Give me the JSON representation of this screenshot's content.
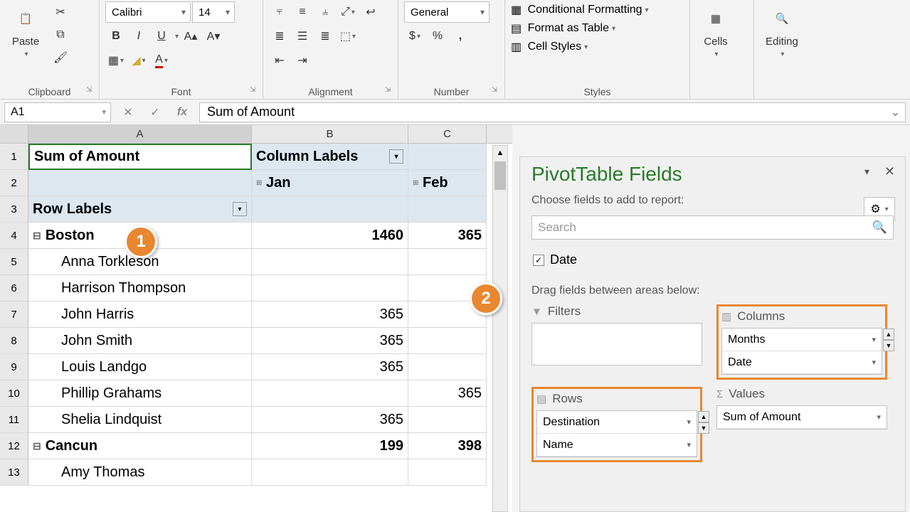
{
  "ribbon": {
    "clipboard": {
      "paste": "Paste",
      "label": "Clipboard"
    },
    "font": {
      "name": "Calibri",
      "size": "14",
      "label": "Font",
      "bold": "B",
      "italic": "I",
      "underline": "U"
    },
    "alignment": {
      "label": "Alignment"
    },
    "number": {
      "format": "General",
      "label": "Number"
    },
    "styles": {
      "cond": "Conditional Formatting",
      "table": "Format as Table",
      "cell": "Cell Styles",
      "label": "Styles"
    },
    "cells": {
      "label": "Cells"
    },
    "editing": {
      "label": "Editing"
    }
  },
  "formula": {
    "name_ref": "A1",
    "value": "Sum of Amount"
  },
  "columns": [
    "A",
    "B",
    "C"
  ],
  "grid": {
    "r1": {
      "a": "Sum of Amount",
      "b": "Column Labels"
    },
    "r2": {
      "b": "Jan",
      "c": "Feb"
    },
    "r3": {
      "a": "Row Labels"
    },
    "r4": {
      "a": "Boston",
      "b": "1460",
      "c": "365"
    },
    "r5": {
      "a": "Anna Torkleson"
    },
    "r6": {
      "a": "Harrison Thompson"
    },
    "r7": {
      "a": "John Harris",
      "b": "365"
    },
    "r8": {
      "a": "John Smith",
      "b": "365"
    },
    "r9": {
      "a": "Louis Landgo",
      "b": "365"
    },
    "r10": {
      "a": "Phillip Grahams",
      "c": "365"
    },
    "r11": {
      "a": "Shelia Lindquist",
      "b": "365"
    },
    "r12": {
      "a": "Cancun",
      "b": "199",
      "c": "398"
    },
    "r13": {
      "a": "Amy Thomas"
    }
  },
  "callouts": {
    "one": "1",
    "two": "2"
  },
  "pane": {
    "title": "PivotTable Fields",
    "choose": "Choose fields to add to report:",
    "search_ph": "Search",
    "field_date": "Date",
    "drag": "Drag fields between areas below:",
    "filters": "Filters",
    "columns": "Columns",
    "rows": "Rows",
    "values": "Values",
    "col_items": {
      "months": "Months",
      "date": "Date"
    },
    "row_items": {
      "dest": "Destination",
      "name": "Name"
    },
    "val_items": {
      "sum": "Sum of Amount"
    }
  }
}
